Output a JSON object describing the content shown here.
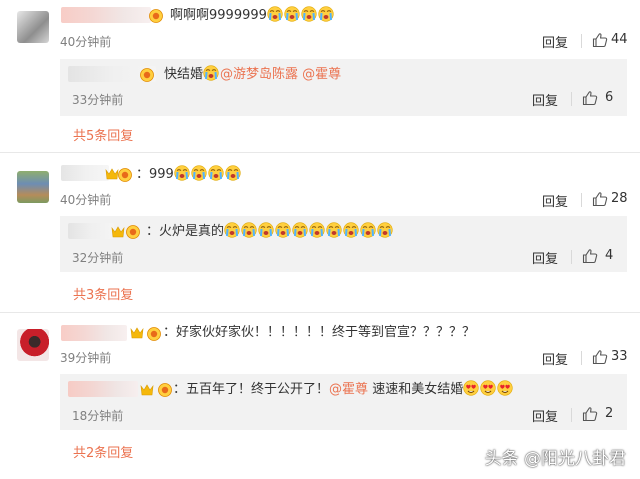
{
  "colors": {
    "accent": "#eb7350",
    "muted": "#808080",
    "subbox_bg": "#f2f2f2"
  },
  "comments": [
    {
      "text": "啊啊啊9999999",
      "emoji_count": 4,
      "time": "40分钟前",
      "reply_label": "回复",
      "likes": "44",
      "sub": {
        "text_prefix": "快结婚",
        "mention1": "@游梦岛陈露",
        "mention2": "@霍尊",
        "time": "33分钟前",
        "reply_label": "回复",
        "likes": "6"
      },
      "more": "共5条回复"
    },
    {
      "text": "999",
      "emoji_count": 4,
      "time": "40分钟前",
      "reply_label": "回复",
      "likes": "28",
      "sub": {
        "text": "火炉是真的",
        "emoji_count": 10,
        "time": "32分钟前",
        "reply_label": "回复",
        "likes": "4"
      },
      "more": "共3条回复"
    },
    {
      "text": "好家伙好家伙！！！！！！终于等到官宣？？？？？",
      "time": "39分钟前",
      "reply_label": "回复",
      "likes": "33",
      "sub": {
        "text_prefix": "五百年了！终于公开了！",
        "mention": "@霍尊",
        "text_suffix": "速速和美女结婚",
        "time": "18分钟前",
        "reply_label": "回复",
        "likes": "2"
      },
      "more": "共2条回复"
    }
  ],
  "watermark": "头条 @阳光八卦君",
  "icons": {
    "like": "thumbs-up-icon",
    "vip": "vip-crown-icon",
    "emoji_cry": "crying-emoji-icon",
    "emoji_heart": "heart-eyes-emoji-icon"
  }
}
